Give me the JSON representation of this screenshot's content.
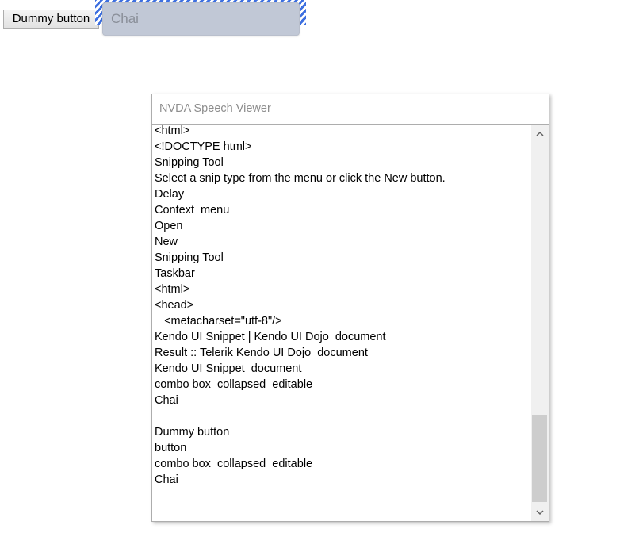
{
  "dummy_button": {
    "label": "Dummy button"
  },
  "combo": {
    "value": "Chai"
  },
  "speech_viewer": {
    "title": "NVDA Speech Viewer",
    "lines": [
      "<html>",
      "<!DOCTYPE html>",
      "Snipping Tool",
      "Select a snip type from the menu or click the New button.",
      "Delay",
      "Context  menu",
      "Open",
      "New",
      "Snipping Tool",
      "Taskbar",
      "<html>",
      "<head>",
      "   <metacharset=\"utf-8\"/>",
      "Kendo UI Snippet | Kendo UI Dojo  document",
      "Result :: Telerik Kendo UI Dojo  document",
      "Kendo UI Snippet  document",
      "combo box  collapsed  editable",
      "Chai",
      "",
      "Dummy button",
      "button",
      "combo box  collapsed  editable",
      "Chai"
    ],
    "scrollbar": {
      "up_icon": "chevron-up-icon",
      "down_icon": "chevron-down-icon",
      "position": 1.0
    }
  },
  "colors": {
    "focus_ring": "#3d6fe0",
    "combo_background": "#c1c8d6"
  }
}
